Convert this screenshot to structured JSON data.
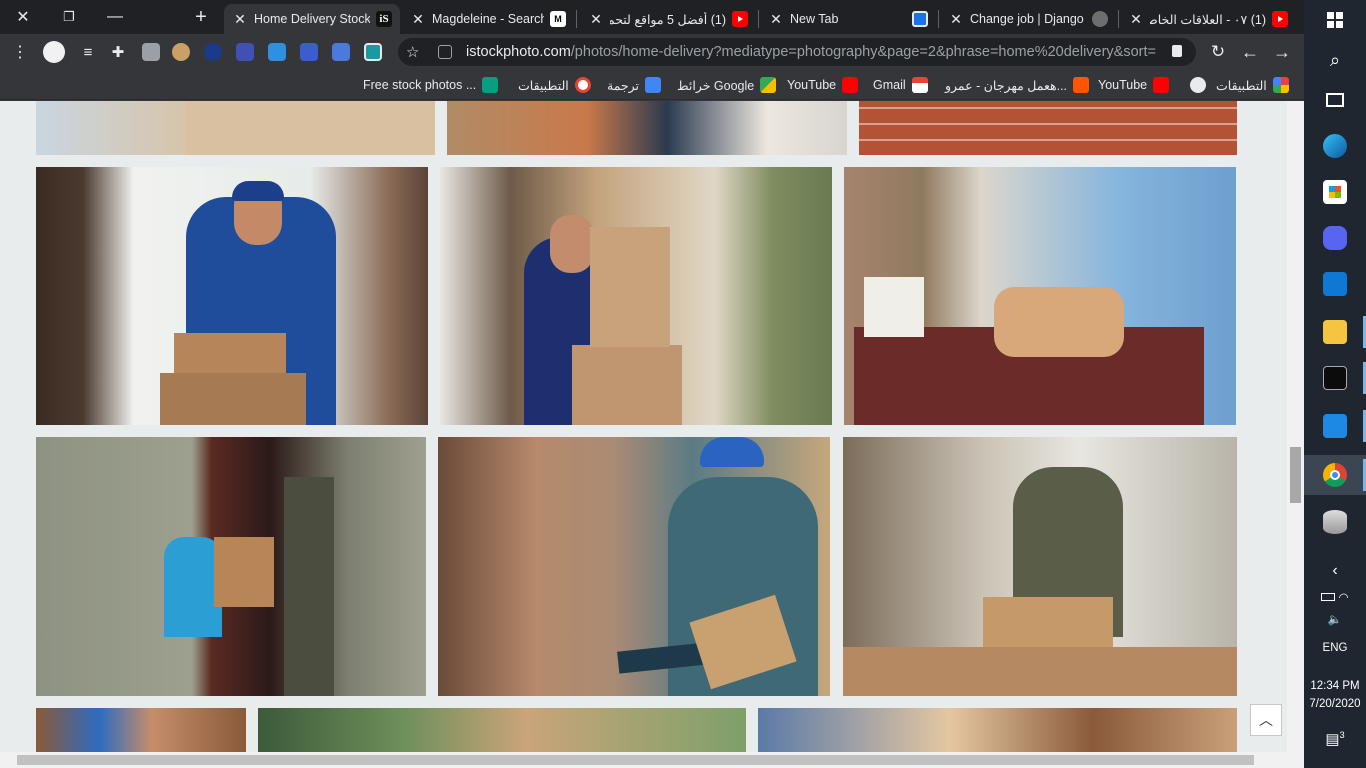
{
  "window": {
    "close": "✕",
    "restore": "❐",
    "minimize": "—",
    "newtab": "+"
  },
  "tabs": [
    {
      "title": "Home Delivery Stock",
      "icon": "istock-icon",
      "active": true
    },
    {
      "title": "Magdeleine - Search",
      "icon": "magdeleine-icon"
    },
    {
      "title": "(1) أفضل 5 مواقع لتحم",
      "icon": "youtube-icon"
    },
    {
      "title": "New Tab",
      "icon": "newtab-icon"
    },
    {
      "title": "Change job | Django",
      "icon": "django-icon"
    },
    {
      "title": "(1) ٠٧ - العلاقات الخاص",
      "icon": "youtube-icon"
    }
  ],
  "toolbar": {
    "url_host": "istockphoto.com",
    "url_path": "/photos/home-delivery?mediatype=photography&page=2&phrase=home%20delivery&sort=..."
  },
  "bookmarks": [
    {
      "label": "التطبيقات",
      "icon": "apps-grid-icon"
    },
    {
      "label": "",
      "icon": "globe-icon"
    },
    {
      "label": "YouTube",
      "icon": "youtube-icon"
    },
    {
      "label": "هعمل مهرجان - عمرو...",
      "icon": "soundcloud-icon"
    },
    {
      "label": "Gmail",
      "icon": "gmail-icon"
    },
    {
      "label": "YouTube",
      "icon": "youtube-icon"
    },
    {
      "label": "خرائط Google",
      "icon": "maps-icon"
    },
    {
      "label": "ترجمة",
      "icon": "translate-icon"
    },
    {
      "label": "التطبيقات",
      "icon": "google-icon"
    },
    {
      "label": "Free stock photos ...",
      "icon": "pexels-icon"
    }
  ],
  "page": {
    "photos": [
      "delivery-box-top-left",
      "shopping-bag-top-middle",
      "brick-wall-top-right",
      "courier-blue-polo-doorway",
      "courier-van-tablet",
      "grocery-basket-delivery",
      "boy-receiving-box-door",
      "courier-tablet-signature",
      "woman-unpacking-box-kitchen",
      "courier-cap-bottom-left",
      "courier-hat-bottom-middle",
      "courier-bottom-right"
    ],
    "back_to_top": "︿"
  },
  "taskbar": {
    "lang": "ENG",
    "time": "12:34 PM",
    "date": "7/20/2020",
    "notifications": "3"
  }
}
